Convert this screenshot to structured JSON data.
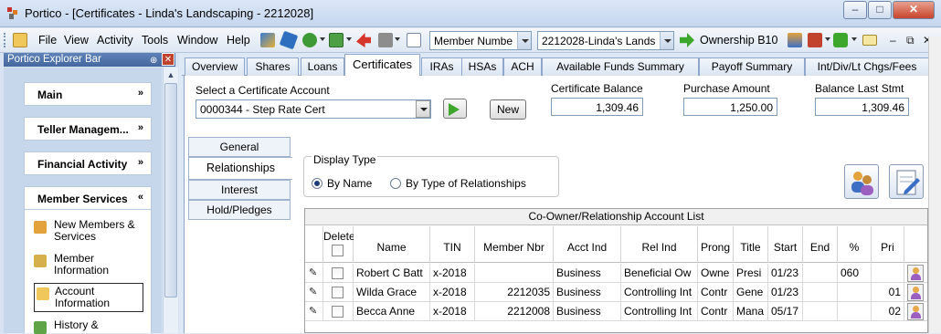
{
  "window": {
    "title": "Portico - [Certificates - Linda's Landscaping - 2212028]",
    "min": "–",
    "max": "□",
    "close": "✕"
  },
  "menu": {
    "file": "File",
    "view": "View",
    "activity": "Activity",
    "tools": "Tools",
    "window": "Window",
    "help": "Help"
  },
  "toolbar": {
    "search_type": "Member Numbe",
    "member": "2212028-Linda's Lands",
    "ownership": "Ownership B10",
    "mdi_min": "–",
    "mdi_restore": "⧉",
    "mdi_close": "✕"
  },
  "explorer": {
    "title": "Portico Explorer Bar",
    "sections": [
      {
        "label": "Main",
        "chevron": "»"
      },
      {
        "label": "Teller Managem...",
        "chevron": "»"
      },
      {
        "label": "Financial Activity",
        "chevron": "»"
      },
      {
        "label": "Member Services",
        "chevron": "«"
      }
    ],
    "links": [
      {
        "label": "New Members & Services"
      },
      {
        "label": "Member Information"
      },
      {
        "label": "Account Information"
      },
      {
        "label": "History &"
      }
    ]
  },
  "tabs": [
    "Overview",
    "Shares",
    "Loans",
    "Certificates",
    "IRAs",
    "HSAs",
    "ACH",
    "Available Funds Summary",
    "Payoff Summary",
    "Int/Div/Lt Chgs/Fees"
  ],
  "certificate": {
    "select_label": "Select a Certificate Account",
    "account": "0000344 - Step Rate Cert",
    "new_label": "New",
    "balance_label": "Certificate Balance",
    "balance": "1,309.46",
    "purchase_label": "Purchase Amount",
    "purchase": "1,250.00",
    "last_stmt_label": "Balance Last Stmt",
    "last_stmt": "1,309.46"
  },
  "side_tabs": [
    "General",
    "Relationships",
    "Interest",
    "Hold/Pledges"
  ],
  "display_type": {
    "label": "Display Type",
    "by_name": "By Name",
    "by_type": "By Type of Relationships"
  },
  "grid": {
    "caption": "Co-Owner/Relationship Account List",
    "headers": [
      "Delete",
      "Name",
      "TIN",
      "Member Nbr",
      "Acct Ind",
      "Rel Ind",
      "Prong",
      "Title",
      "Start",
      "End",
      "%",
      "Pri"
    ],
    "rows": [
      {
        "name": "Robert C Batt",
        "tin": "x-2018",
        "member": "",
        "acct": "Business",
        "rel": "Beneficial Ow",
        "prong": "Owne",
        "title": "Presi",
        "start": "01/23",
        "end": "",
        "pct": "060",
        "pri": ""
      },
      {
        "name": "Wilda Grace",
        "tin": "x-2018",
        "member": "2212035",
        "acct": "Business",
        "rel": "Controlling Int",
        "prong": "Contr",
        "title": "Gene",
        "start": "01/23",
        "end": "",
        "pct": "",
        "pri": "01"
      },
      {
        "name": "Becca Anne",
        "tin": "x-2018",
        "member": "2212008",
        "acct": "Business",
        "rel": "Controlling Int",
        "prong": "Contr",
        "title": "Mana",
        "start": "05/17",
        "end": "",
        "pct": "",
        "pri": "02"
      }
    ]
  }
}
